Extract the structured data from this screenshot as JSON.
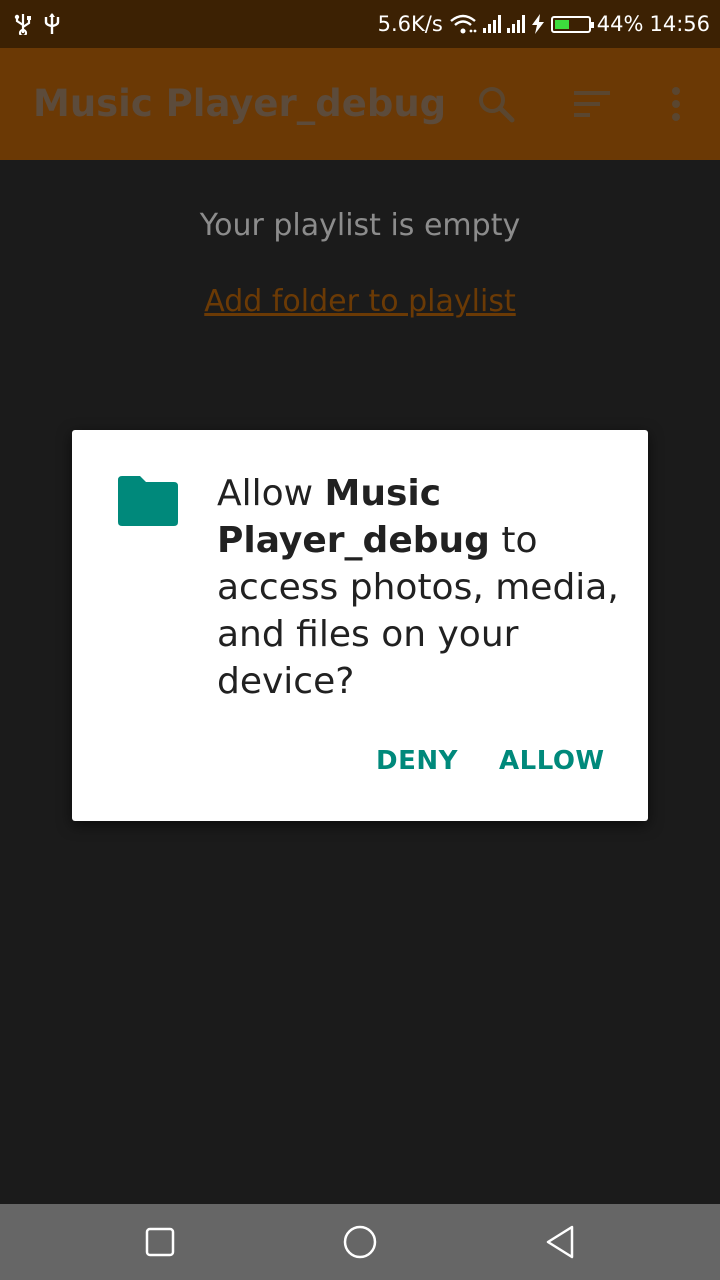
{
  "status_bar": {
    "left_icons": [
      "usb-icon",
      "usb-debug-icon"
    ],
    "net_speed": "5.6K/s",
    "battery_percent": "44%",
    "battery_level": 0.44,
    "time": "14:56",
    "battery_fill_color": "#3ddc3d"
  },
  "app_bar": {
    "title": "Music Player_debug",
    "icons": [
      "search-icon",
      "sort-icon",
      "more-vert-icon"
    ],
    "background": "#6b3905"
  },
  "content": {
    "empty_message": "Your playlist is empty",
    "add_folder_link": "Add folder to playlist"
  },
  "dialog": {
    "icon": "folder-icon",
    "message_prefix": "Allow ",
    "app_name": "Music Player_debug",
    "message_suffix": " to access photos, media, and files on your device?",
    "deny_label": "DENY",
    "allow_label": "ALLOW",
    "accent_color": "#00897b"
  },
  "nav_bar": {
    "icons": [
      "recents-square-icon",
      "home-circle-icon",
      "back-triangle-icon"
    ]
  }
}
